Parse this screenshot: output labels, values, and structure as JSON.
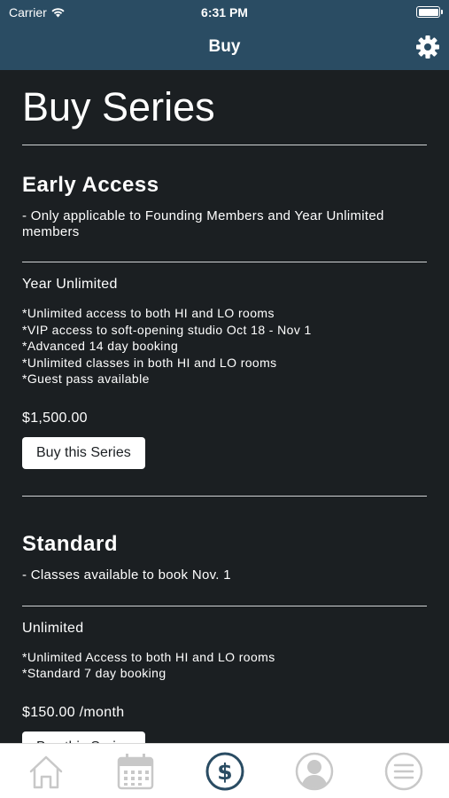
{
  "status": {
    "carrier": "Carrier",
    "time": "6:31 PM"
  },
  "nav": {
    "title": "Buy",
    "settings_icon": "gear-icon"
  },
  "page": {
    "title": "Buy Series"
  },
  "sections": [
    {
      "title": "Early Access",
      "description": "- Only applicable to Founding Members and Year Unlimited members",
      "item": {
        "name": "Year Unlimited",
        "features": [
          "*Unlimited access to both HI and LO rooms",
          "*VIP access to soft-opening studio Oct 18 - Nov 1",
          "*Advanced 14 day booking",
          "*Unlimited classes in both HI and LO rooms",
          "*Guest pass available"
        ],
        "price": "$1,500.00",
        "button": "Buy this Series"
      }
    },
    {
      "title": "Standard",
      "description": "- Classes available to book Nov. 1",
      "item": {
        "name": "Unlimited",
        "features": [
          "*Unlimited Access to both HI and LO rooms",
          "*Standard 7 day booking"
        ],
        "price": "$150.00 /month",
        "button": "Buy this Series"
      }
    }
  ],
  "tabs": [
    "home-icon",
    "calendar-icon",
    "dollar-icon",
    "profile-icon",
    "menu-icon"
  ],
  "colors": {
    "header": "#2a4c63",
    "background": "#1b1f22",
    "tab_active": "#2a4c63",
    "tab_inactive": "#c8c8c8"
  }
}
